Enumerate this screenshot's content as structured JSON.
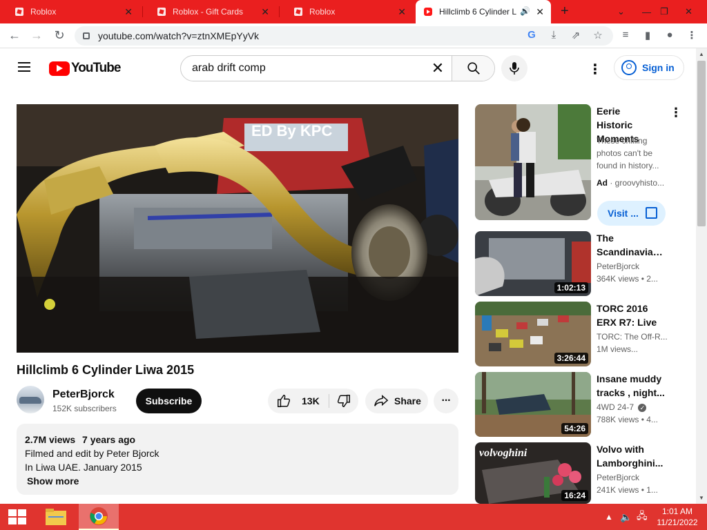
{
  "browser": {
    "tabs": [
      {
        "title": "Roblox",
        "active": false
      },
      {
        "title": "Roblox - Gift Cards",
        "active": false
      },
      {
        "title": "Roblox",
        "active": false
      },
      {
        "title": "Hillclimb 6 Cylinder L",
        "active": true
      }
    ],
    "url": "youtube.com/watch?v=ztnXMEpYyVk",
    "tab_strip_color": "#ea1f1f"
  },
  "youtube": {
    "logo_text": "YouTube",
    "search_value": "arab drift comp",
    "signin_label": "Sign in"
  },
  "video": {
    "overlay_text": "ED By KPC",
    "title": "Hillclimb 6 Cylinder Liwa 2015",
    "channel": "PeterBjorck",
    "subscribers": "152K subscribers",
    "subscribe_label": "Subscribe",
    "likes": "13K",
    "share_label": "Share",
    "views": "2.7M views",
    "age": "7 years ago",
    "description_lines": [
      "Filmed and edit by Peter Bjorck",
      "In Liwa UAE. January 2015"
    ],
    "show_more": "Show more"
  },
  "ad": {
    "title_lines": [
      "Eerie Historic",
      "Moments"
    ],
    "description": "These chilling photos can't be found in history...",
    "ad_label": "Ad",
    "advertiser": "· groovyhisto...",
    "visit_label": "Visit ..."
  },
  "recommendations": [
    {
      "title_lines": [
        "The",
        "Scandinavian..."
      ],
      "channel": "PeterBjorck",
      "views": "364K views • 2...",
      "duration": "1:02:13"
    },
    {
      "title_lines": [
        "TORC 2016",
        "ERX R7: Live"
      ],
      "channel": "TORC: The Off-R...",
      "views": "1M views...",
      "duration": "3:26:44"
    },
    {
      "title_lines": [
        "Insane muddy",
        "tracks , night..."
      ],
      "channel": "4WD 24-7",
      "views": "788K views • 4...",
      "duration": "54:26",
      "verified": true
    },
    {
      "title_lines": [
        "Volvo with",
        "Lamborghini..."
      ],
      "channel": "PeterBjorck",
      "views": "241K views • 1...",
      "duration": "16:24",
      "thumb_text": "volvoghini"
    }
  ],
  "taskbar": {
    "time": "1:01 AM",
    "date": "11/21/2022",
    "color": "#e0342f"
  }
}
